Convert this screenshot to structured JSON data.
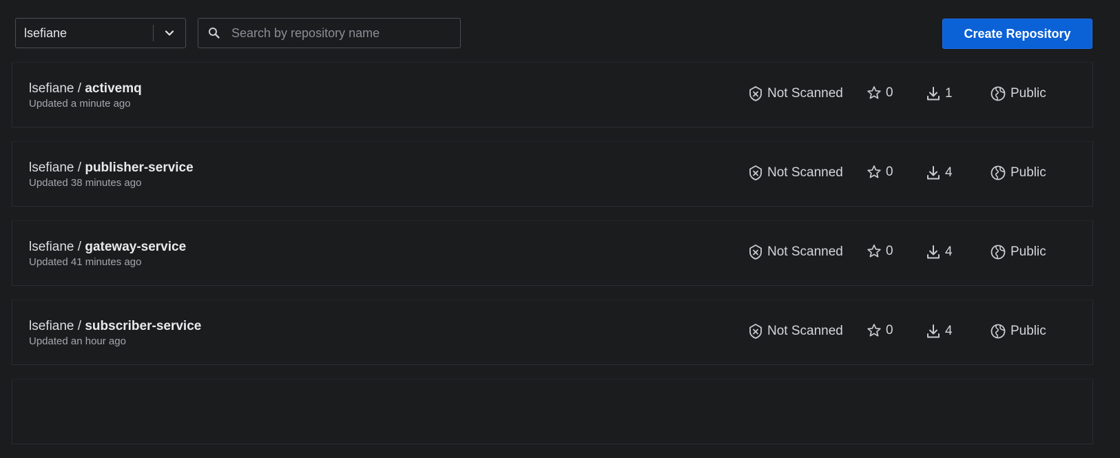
{
  "toolbar": {
    "namespace": "lsefiane",
    "search_placeholder": "Search by repository name",
    "create_label": "Create Repository"
  },
  "repos": [
    {
      "owner": "lsefiane",
      "separator": " / ",
      "name": "activemq",
      "updated": "Updated a minute ago",
      "scan": "Not Scanned",
      "stars": "0",
      "pulls": "1",
      "visibility": "Public"
    },
    {
      "owner": "lsefiane",
      "separator": " / ",
      "name": "publisher-service",
      "updated": "Updated 38 minutes ago",
      "scan": "Not Scanned",
      "stars": "0",
      "pulls": "4",
      "visibility": "Public"
    },
    {
      "owner": "lsefiane",
      "separator": " / ",
      "name": "gateway-service",
      "updated": "Updated 41 minutes ago",
      "scan": "Not Scanned",
      "stars": "0",
      "pulls": "4",
      "visibility": "Public"
    },
    {
      "owner": "lsefiane",
      "separator": " / ",
      "name": "subscriber-service",
      "updated": "Updated an hour ago",
      "scan": "Not Scanned",
      "stars": "0",
      "pulls": "4",
      "visibility": "Public"
    }
  ],
  "icons": {
    "namespace_chevron": "chevron-down-icon",
    "search": "search-icon",
    "scan": "shield-x-icon",
    "stars": "star-icon",
    "pulls": "download-icon",
    "visibility": "globe-icon"
  },
  "colors": {
    "background": "#1b1c1e",
    "primary_button": "#0b61d6",
    "border": "#4b4e53"
  }
}
